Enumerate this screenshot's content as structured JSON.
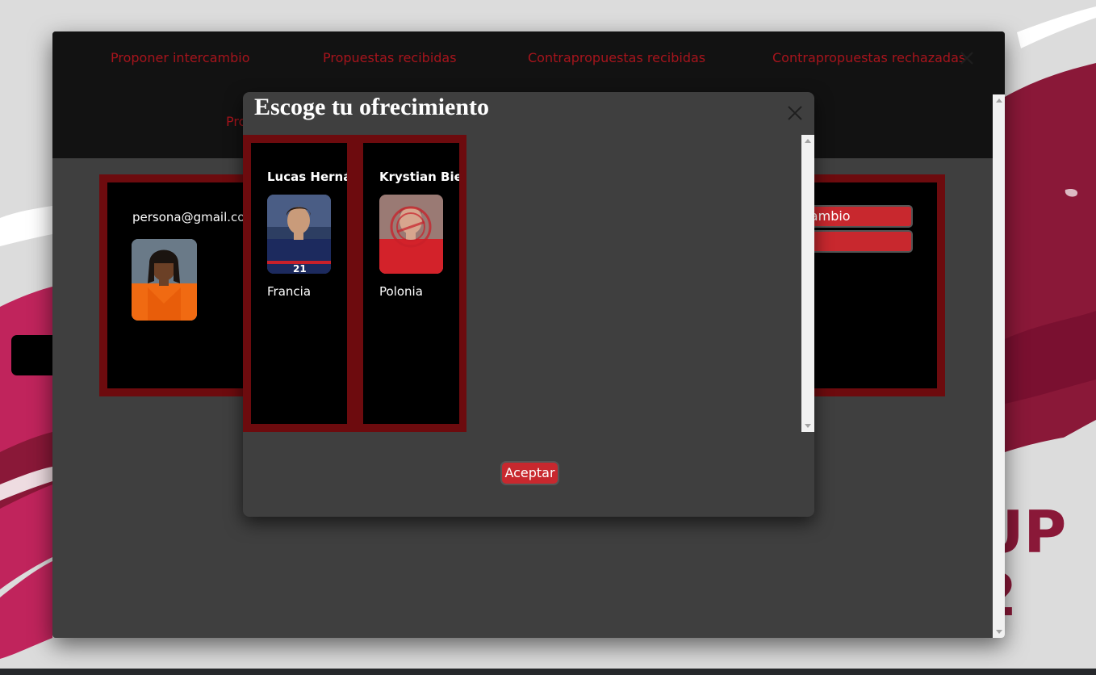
{
  "colors": {
    "accent_red": "#c8282e",
    "dark_red_border": "#6d0b0e",
    "nav_link_red": "#a6141c",
    "panel_grey": "#3f3f3f",
    "header_black": "#121212",
    "background_magenta": "#8a1838"
  },
  "background": {
    "wordmark_line1": "UP",
    "wordmark_line2": "2"
  },
  "main_window": {
    "nav": [
      {
        "label": "Proponer intercambio"
      },
      {
        "label": "Propuestas recibidas"
      },
      {
        "label": "Contrapropuestas recibidas"
      },
      {
        "label": "Contrapropuestas rechazadas"
      }
    ],
    "second_row_partial": "Pro",
    "close_icon": "close-x-icon",
    "card": {
      "email": "persona@gmail.com",
      "buttons": [
        {
          "label": "cambio"
        },
        {
          "label": ""
        }
      ]
    }
  },
  "modal": {
    "title": "Escoge tu ofrecimiento",
    "close_icon": "close-x-icon",
    "players": [
      {
        "name": "Lucas Hernández",
        "country": "Francia"
      },
      {
        "name": "Krystian Bielik",
        "country": "Polonia"
      }
    ],
    "accept_label": "Aceptar"
  }
}
